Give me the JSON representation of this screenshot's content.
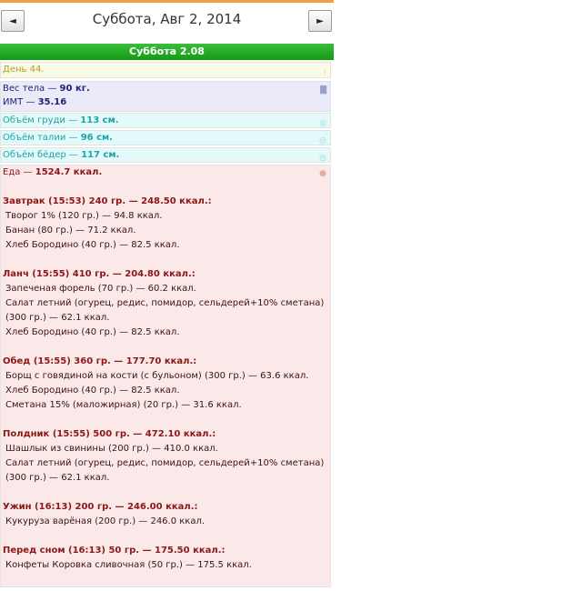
{
  "header": {
    "title": "Суббота, Авг 2, 2014",
    "prev_glyph": "◄",
    "next_glyph": "►"
  },
  "day_bar": {
    "label": "Суббота 2.08"
  },
  "day_row": {
    "label": "День 44."
  },
  "weight": {
    "label": "Вес тела",
    "value": "90 кг.",
    "bmi_label": "ИМТ",
    "bmi_value": "35.16"
  },
  "measurements": [
    {
      "label": "Объём груди",
      "value": "113 см."
    },
    {
      "label": "Объём талии",
      "value": "96 см."
    },
    {
      "label": "Объём бёдер",
      "value": "117 см."
    }
  ],
  "food": {
    "label": "Еда",
    "total": "1524.7 ккал.",
    "meals": [
      {
        "title": "Завтрак (15:53) 240 гр. — 248.50 ккал.:",
        "items": [
          "Творог 1% (120 гр.) — 94.8 ккал.",
          "Банан (80 гр.) — 71.2 ккал.",
          "Хлеб Бородино (40 гр.) — 82.5 ккал."
        ]
      },
      {
        "title": "Ланч (15:55) 410 гр. — 204.80 ккал.:",
        "items": [
          "Запеченая форель (70 гр.) — 60.2 ккал.",
          "Салат летний (огурец, редис, помидор, сельдерей+10% сметана) (300 гр.) — 62.1 ккал.",
          "Хлеб Бородино (40 гр.) — 82.5 ккал."
        ]
      },
      {
        "title": "Обед (15:55) 360 гр. — 177.70 ккал.:",
        "items": [
          "Борщ с говядиной на кости (с бульоном) (300 гр.) — 63.6 ккал.",
          "Хлеб Бородино (40 гр.) — 82.5 ккал.",
          "Сметана 15% (маложирная) (20 гр.) — 31.6 ккал."
        ]
      },
      {
        "title": "Полдник (15:55) 500 гр. — 472.10 ккал.:",
        "items": [
          "Шашлык из свинины (200 гр.) — 410.0 ккал.",
          "Салат летний (огурец, редис, помидор, сельдерей+10% сметана) (300 гр.) — 62.1 ккал."
        ]
      },
      {
        "title": "Ужин (16:13) 200 гр. — 246.00 ккал.:",
        "items": [
          "Кукуруза варёная (200 гр.) — 246.0 ккал."
        ]
      },
      {
        "title": "Перед сном (16:13) 50 гр. — 175.50 ккал.:",
        "items": [
          "Конфеты Коровка сливочная (50 гр.) — 175.5 ккал."
        ]
      }
    ]
  },
  "icons": {
    "day": "exclamation-icon",
    "weight": "scale-icon",
    "measure": "tape-icon",
    "food": "apple-icon"
  },
  "colors": {
    "header_accent": "#f0a040",
    "day_bar": "#1aa51a"
  }
}
